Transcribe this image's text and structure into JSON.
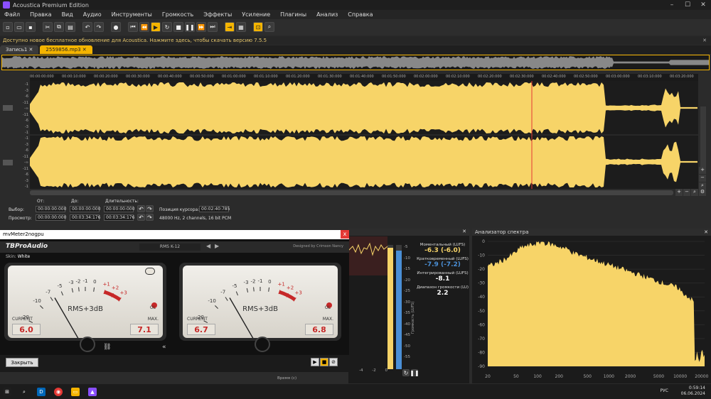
{
  "window": {
    "title": "Acoustica Premium Edition",
    "controls": [
      "–",
      "☐",
      "✕"
    ]
  },
  "menu": [
    "Файл",
    "Правка",
    "Вид",
    "Аудио",
    "Инструменты",
    "Громкость",
    "Эффекты",
    "Усиление",
    "Плагины",
    "Анализ",
    "Справка"
  ],
  "notice": {
    "text": "Доступно новое бесплатное обновление для Acoustica. Нажмите здесь, чтобы скачать версию 7.5.5",
    "close": "✕"
  },
  "tabs": [
    {
      "label": "Запись1 ✕"
    },
    {
      "label": "2559856.mp3 ✕"
    }
  ],
  "ruler": [
    "00:00:00:000",
    "00:00:10:000",
    "00:00:20:000",
    "00:00:30:000",
    "00:00:40:000",
    "00:00:50:000",
    "00:01:00:000",
    "00:01:10:000",
    "00:01:20:000",
    "00:01:30:000",
    "00:01:40:000",
    "00:01:50:000",
    "00:02:00:000",
    "00:02:10:000",
    "00:02:20:000",
    "00:02:30:000",
    "00:02:40:000",
    "00:02:50:000",
    "00:03:00:000",
    "00:03:10:000",
    "00:03:20:000"
  ],
  "yaxis_top": [
    "-1",
    "-3",
    "-6",
    "-11",
    "-∞",
    "-11",
    "-6",
    "-3",
    "-1"
  ],
  "yaxis_bot": [
    "-1",
    "-3",
    "-6",
    "-11",
    "-∞",
    "-11",
    "-6",
    "-3",
    "-1"
  ],
  "selection": {
    "from_label": "От:",
    "to_label": "До:",
    "length_label": "Длительность:",
    "sel_label": "Выбор:",
    "view_label": "Просмотр:",
    "sel_from": "00:00:00:000",
    "sel_to": "00:00:00:000",
    "sel_len": "00:00:00:000",
    "view_from": "00:00:00:000",
    "view_to": "00:03:34:176",
    "view_len": "00:03:34:176",
    "cursor_label": "Позиция курсора:",
    "cursor": "00:02:40:785",
    "format": "48000 Hz, 2 channels, 16 bit PCM"
  },
  "plugin": {
    "title": "mvMeter2nogpu",
    "close": "x",
    "brand": "TBProAudio",
    "preset": "RMS K-12",
    "credit": "Designed by Crimson Nancy",
    "skin_label": "Skin:",
    "skin": "White",
    "ticks": [
      "-20",
      "-10",
      "-7",
      "-5",
      "-3",
      "-2",
      "-1",
      "0",
      "+1",
      "+2",
      "+3"
    ],
    "rms": "RMS+3dB",
    "current_label": "CURRENT",
    "max_label": "MAX.",
    "ol": "OL",
    "left": {
      "current": "6.0",
      "max": "7.1"
    },
    "right": {
      "current": "6.7",
      "max": "6.8"
    },
    "close_button": "Закрыть"
  },
  "loudness": {
    "momentary_label": "Моментальный (LUFS)",
    "momentary": "-6.3 (-6.0)",
    "short_label": "Кратковременный (LUFS)",
    "short": "-7.9 (-7.2)",
    "integrated_label": "Интегрированный (LUFS)",
    "integrated": "-8.1",
    "range_label": "Диапазон громкости (LU)",
    "range": "2.2",
    "scale": [
      "-5",
      "-10",
      "-15",
      "-20",
      "-25",
      "-30",
      "-35",
      "-40",
      "-45",
      "-50",
      "-55"
    ],
    "axis_label": "Громкость (LUFS)",
    "time_label": "Время (с)",
    "time_ticks": [
      "-4",
      "-2",
      "0"
    ]
  },
  "spectrum": {
    "title": "Анализатор спектра",
    "y_ticks": [
      "0",
      "-10",
      "-20",
      "-30",
      "-40",
      "-50",
      "-60",
      "-70",
      "-80",
      "-90"
    ],
    "x_ticks": [
      "20",
      "50",
      "100",
      "200",
      "500",
      "1000",
      "2000",
      "5000",
      "10000",
      "20000"
    ]
  },
  "taskbar": {
    "lang": "РУС",
    "time": "0:59:14",
    "date": "06.06.2024"
  },
  "colors": {
    "accent": "#f4b400",
    "waveform": "#f7d468",
    "cursor": "#e53935"
  }
}
